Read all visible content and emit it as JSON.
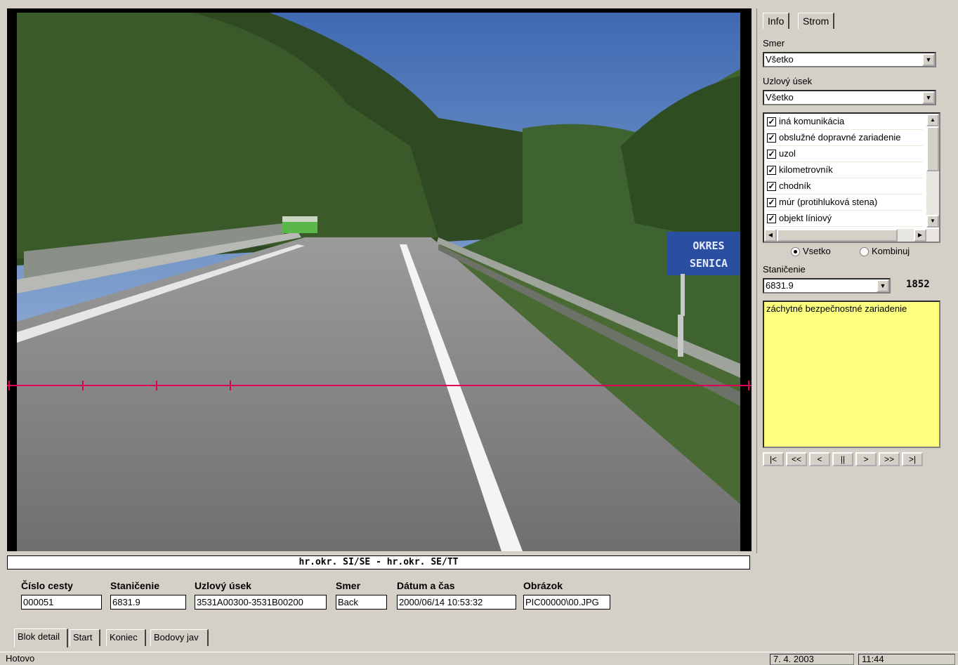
{
  "right_panel": {
    "tabs": [
      {
        "label": "Info"
      },
      {
        "label": "Strom"
      }
    ],
    "smer_label": "Smer",
    "smer_value": "Všetko",
    "uzlovy_label": "Uzlový úsek",
    "uzlovy_value": "Všetko",
    "features": [
      {
        "label": "iná komunikácia",
        "checked": true
      },
      {
        "label": "obslužné dopravné zariadenie",
        "checked": true
      },
      {
        "label": "uzol",
        "checked": true
      },
      {
        "label": "kilometrovník",
        "checked": true
      },
      {
        "label": "chodník",
        "checked": true
      },
      {
        "label": "múr (protihluková stena)",
        "checked": true
      },
      {
        "label": "objekt líniový",
        "checked": true
      }
    ],
    "radio_all": "Vsetko",
    "radio_combine": "Kombinuj",
    "stanicenie_label": "Staničenie",
    "stanicenie_value": "6831.9",
    "count": "1852",
    "note": "záchytné bezpečnostné zariadenie",
    "nav": [
      "|<",
      "<<",
      "<",
      "||",
      ">",
      ">>",
      ">|"
    ]
  },
  "photo": {
    "sign_line1": "OKRES",
    "sign_line2": "SENICA"
  },
  "route_title": "hr.okr. SI/SE - hr.okr. SE/TT",
  "fields": {
    "cislo_cesty": {
      "label": "Číslo cesty",
      "value": "000051"
    },
    "stanicenie": {
      "label": "Staničenie",
      "value": "6831.9"
    },
    "uzlovy_usek": {
      "label": "Uzlový úsek",
      "value": "3531A00300-3531B00200"
    },
    "smer": {
      "label": "Smer",
      "value": "Back"
    },
    "datum": {
      "label": "Dátum a čas",
      "value": "2000/06/14 10:53:32"
    },
    "obrazok": {
      "label": "Obrázok",
      "value": "PIC00000\\00.JPG"
    }
  },
  "bottom_tabs": [
    {
      "label": "Blok detail"
    },
    {
      "label": "Start"
    },
    {
      "label": "Koniec"
    },
    {
      "label": "Bodovy jav"
    }
  ],
  "status": {
    "left": "Hotovo",
    "date": "7. 4. 2003",
    "time": "11:44"
  },
  "colors": {
    "note_bg": "#ffff80",
    "measure_line": "#e0005a",
    "sign_blue": "#2a4fa0"
  }
}
